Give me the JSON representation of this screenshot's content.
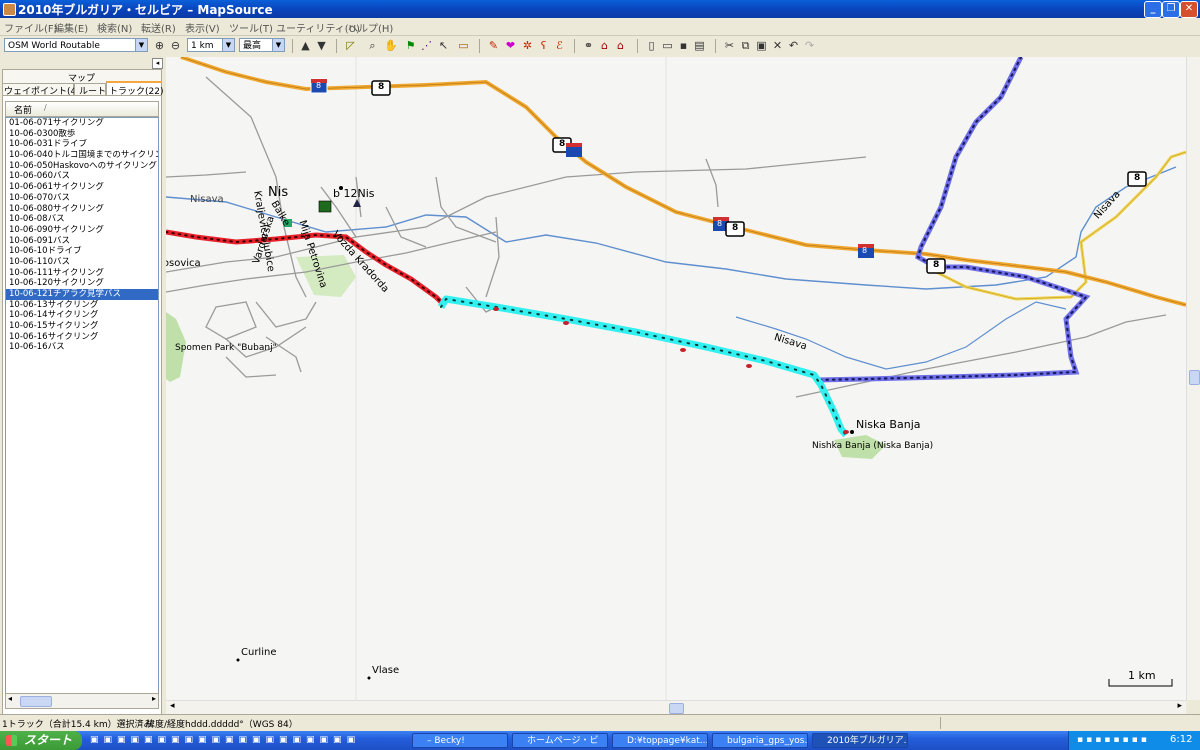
{
  "window": {
    "title": "2010年ブルガリア・セルビア – MapSource",
    "min": "_",
    "max": "❐",
    "close": "✕"
  },
  "menu": [
    "ファイル(F)",
    "編集(E)",
    "検索(N)",
    "転送(R)",
    "表示(V)",
    "ツール(T)",
    "ユーティリティ(U)",
    "ヘルプ(H)"
  ],
  "toolbar": {
    "map_product": "OSM World Routable",
    "zoom_level": "1 km",
    "detail": "最高"
  },
  "left_panel": {
    "header": "マップ",
    "tab_waypoints": "ウェイポイント(49)",
    "tab_routes": "ルート",
    "tab_tracks": "トラック(22)",
    "column_name": "名前",
    "tracks": [
      "01-06-071サイクリング",
      "10-06-0300散歩",
      "10-06-031ドライブ",
      "10-06-040トルコ国境までのサイクリング",
      "10-06-050Haskovoへのサイクリング",
      "10-06-060バス",
      "10-06-061サイクリング",
      "10-06-070バス",
      "10-06-080サイクリング",
      "10-06-08バス",
      "10-06-090サイクリング",
      "10-06-091バス",
      "10-06-10ドライブ",
      "10-06-110バス",
      "10-06-111サイクリング",
      "10-06-120サイクリング",
      "10-06-121チアラク見学バス",
      "10-06-13サイクリング",
      "10-06-14サイクリング",
      "10-06-15サイクリング",
      "10-06-16サイクリング",
      "10-06-16バス"
    ],
    "selected_index": 16
  },
  "map": {
    "labels": {
      "nis": "Nis",
      "b12nis": "b 12Nis",
      "nisava_river_1": "Nisava",
      "nisava_river_2": "Nisava",
      "nisava_river_3": "Nisava",
      "vozda": "Vozda Kradorda",
      "mija": "Mija Petrovina",
      "vardarska": "Vardarska",
      "kraljevica": "Kraljevica Jubice",
      "balke": "Balke",
      "ivosovica": "Ivosovica",
      "spomen": "Spomen Park \"Bubanj\"",
      "niska_banja": "Niska Banja",
      "nishka": "Nishka Banja (Niska Banja)",
      "curline": "Curline",
      "vlase": "Vlase"
    },
    "road_shield": "8",
    "scale": "1 km",
    "colors": {
      "highway": "#f0a830",
      "track_selected": "#33f0f0",
      "track_red": "#e8202a",
      "track_blue": "#6f6fe8",
      "river": "#5f8fcf",
      "road": "#9a9a9a"
    }
  },
  "status": {
    "selection": "1トラック（合計15.4 km）選択済み",
    "coords": "緯度/経度hddd.ddddd°（WGS 84）"
  },
  "taskbar": {
    "start": "スタート",
    "tasks": [
      "– Becky!",
      "ホームページ・ビ",
      "D:¥toppage¥kat...",
      "bulgaria_gps_yos...",
      "2010年ブルガリア..."
    ],
    "clock": "6:12"
  }
}
